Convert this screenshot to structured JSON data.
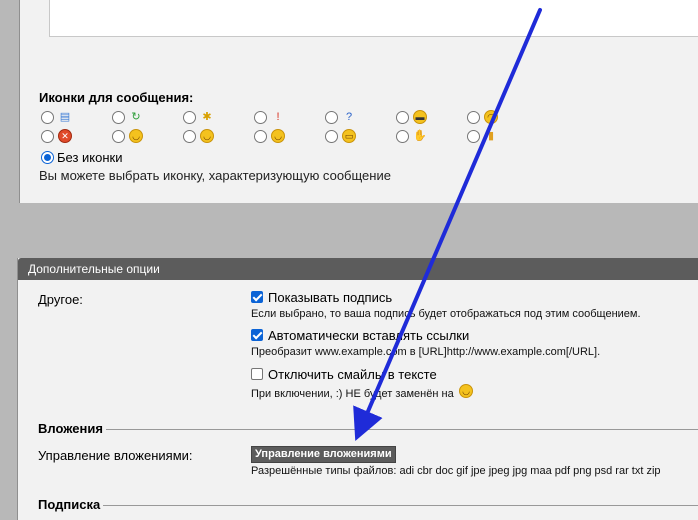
{
  "message_icons": {
    "title": "Иконки для сообщения:",
    "icons": [
      {
        "name": "document-icon",
        "glyph": "▤",
        "color": "#3a7bd5",
        "smiley": false
      },
      {
        "name": "refresh-icon",
        "glyph": "↻",
        "color": "#2e9e3a",
        "smiley": false
      },
      {
        "name": "lightbulb-icon",
        "glyph": "✱",
        "color": "#d8a000",
        "smiley": false
      },
      {
        "name": "exclamation-icon",
        "glyph": "!",
        "color": "#d83020",
        "smiley": false
      },
      {
        "name": "question-icon",
        "glyph": "?",
        "color": "#2a62c9",
        "smiley": false
      },
      {
        "name": "cool-smiley-icon",
        "glyph": "▬",
        "color": "#333333",
        "smiley": true
      },
      {
        "name": "wink-smiley-icon",
        "glyph": "◠",
        "color": "#6a3c00",
        "smiley": true
      },
      {
        "name": "angry-smiley-icon",
        "glyph": "✕",
        "color": "#ffffff",
        "smiley": true,
        "fill": "#e04a2a"
      },
      {
        "name": "grin-smiley-icon",
        "glyph": "◡",
        "color": "#6a3c00",
        "smiley": true
      },
      {
        "name": "laugh-smiley-icon",
        "glyph": "◡",
        "color": "#6a3c00",
        "smiley": true
      },
      {
        "name": "happy-smiley-icon",
        "glyph": "◡",
        "color": "#6a3c00",
        "smiley": true
      },
      {
        "name": "big-grin-smiley-icon",
        "glyph": "▭",
        "color": "#6a3c00",
        "smiley": true
      },
      {
        "name": "thumbs-down-icon",
        "glyph": "✋",
        "color": "#d86020",
        "smiley": false
      },
      {
        "name": "bar-chart-icon",
        "glyph": "▮",
        "color": "#e0a020",
        "smiley": false
      }
    ],
    "no_icon_label": "Без иконки",
    "hint": "Вы можете выбрать иконку, характеризующую сообщение"
  },
  "extra_options": {
    "header": "Дополнительные опции",
    "other_label": "Другое:",
    "options": [
      {
        "label": "Показывать подпись",
        "desc": "Если выбрано, то ваша подпись будет отображаться под этим сообщением.",
        "checked": true
      },
      {
        "label": "Автоматически вставлять ссылки",
        "desc": "Преобразит www.example.com в [URL]http://www.example.com[/URL].",
        "checked": true
      },
      {
        "label": "Отключить смайлы в тексте",
        "desc": "При включении, :) НЕ будет заменён на",
        "checked": false
      }
    ]
  },
  "attachments": {
    "legend": "Вложения",
    "label": "Управление вложениями:",
    "button": "Управление вложениями",
    "allowed": "Разрешённые типы файлов: adi cbr doc gif jpe jpeg jpg maa pdf png psd rar txt zip"
  },
  "subscription": {
    "legend": "Подписка"
  },
  "colors": {
    "arrow": "#1f2bd8",
    "header_bg": "#5c5c5c",
    "panel_bg": "#f2f2f2",
    "outer_bg": "#b8b8b8"
  }
}
